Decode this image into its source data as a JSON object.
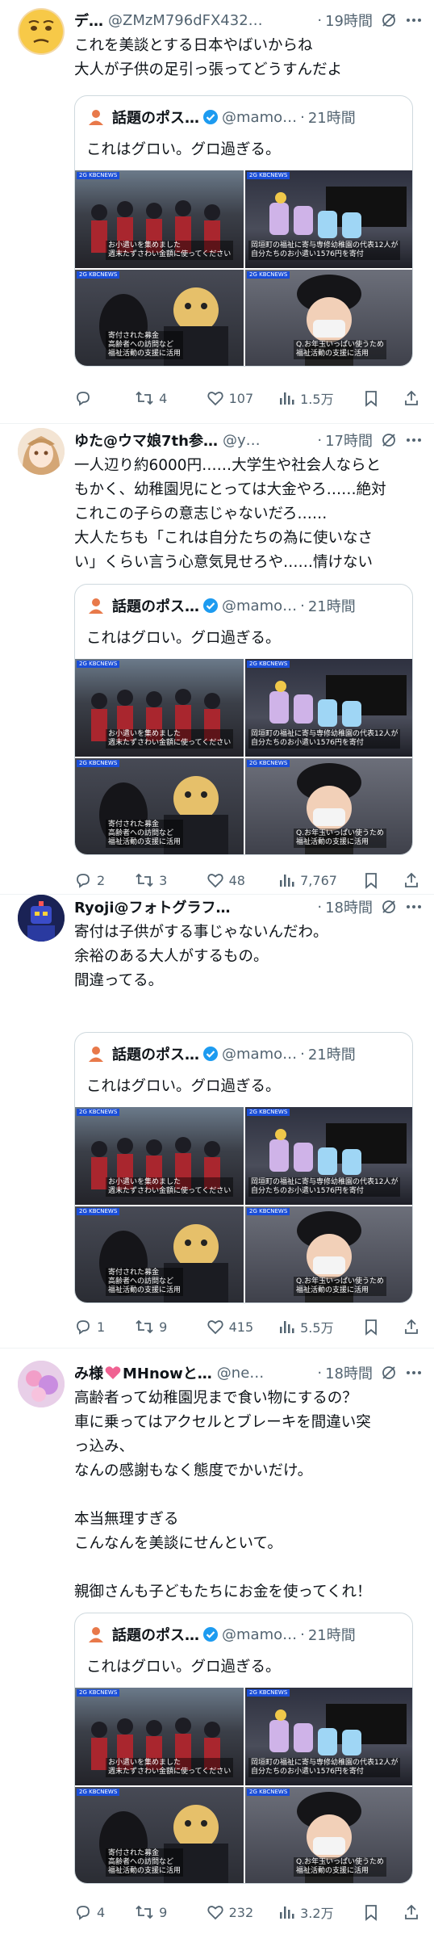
{
  "tweets": [
    {
      "name": "デ…",
      "handle": "@ZMzM796dFX432…",
      "time": "19時間",
      "lines": [
        "これを美談とする日本やばいからね",
        "大人が子供の足引っ張ってどうすんだよ"
      ],
      "avatar_icon": "emoji-face-avatar",
      "reply_count": "",
      "retweet_count": "4",
      "like_count": "107",
      "view_count": "1.5万"
    },
    {
      "name": "ゆた@ウマ娘7th参…",
      "handle": "@y…",
      "time": "17時間",
      "lines": [
        "一人辺り約6000円……大学生や社会人ならと",
        "もかく、幼稚園児にとっては大金やろ……絶対",
        "これこの子らの意志じゃないだろ……",
        "大人たちも「これは自分たちの為に使いなさ",
        "い」くらい言う心意気見せろや……情けない"
      ],
      "avatar_icon": "anime-girl-avatar",
      "reply_count": "2",
      "retweet_count": "3",
      "like_count": "48",
      "view_count": "7,767"
    },
    {
      "name": "Ryoji@フォトグラフ…",
      "handle": "",
      "time": "18時間",
      "lines": [
        "寄付は子供がする事じゃないんだわ。",
        "余裕のある大人がするもの。",
        "間違ってる。"
      ],
      "avatar_icon": "robot-avatar",
      "reply_count": "1",
      "retweet_count": "9",
      "like_count": "415",
      "view_count": "5.5万"
    },
    {
      "name": "み様",
      "name_suffix": "MHnowと…",
      "handle": "@ne…",
      "time": "18時間",
      "lines": [
        "高齢者って幼稚園児まで食い物にするの？",
        "車に乗ってはアクセルとブレーキを間違い突",
        "っ込み、",
        "なんの感謝もなく態度でかいだけ。",
        "",
        "本当無理すぎる",
        "こんなんを美談にせんといて。",
        "",
        "親御さんも子どもたちにお金を使ってくれ！"
      ],
      "avatar_icon": "pink-avatar",
      "reply_count": "4",
      "retweet_count": "9",
      "like_count": "232",
      "view_count": "3.2万"
    }
  ],
  "quote": {
    "name": "話題のポス…",
    "handle": "@mamo…",
    "time": "21時間",
    "text": "これはグロい。グロ過ぎる。",
    "tile_badge": "2G KBCNEWS",
    "tile_captions": [
      "お小遣いを集めました\n週末たずさわい金額に使ってください",
      "岡垣町の福祉に寄与専修幼稚園の代表12人が\n自分たちのお小遣い1576円を寄付",
      "寄付された募金\n高齢者への訪問など\n福祉活動の支援に活用",
      "Q.お年玉いっぱい使うため\n福祉活動の支援に活用"
    ]
  },
  "colors": {
    "text": "#0f1419",
    "muted": "#536471",
    "verified": "#1d9bf0",
    "heart": "#f91880",
    "border": "#cfd9de"
  }
}
